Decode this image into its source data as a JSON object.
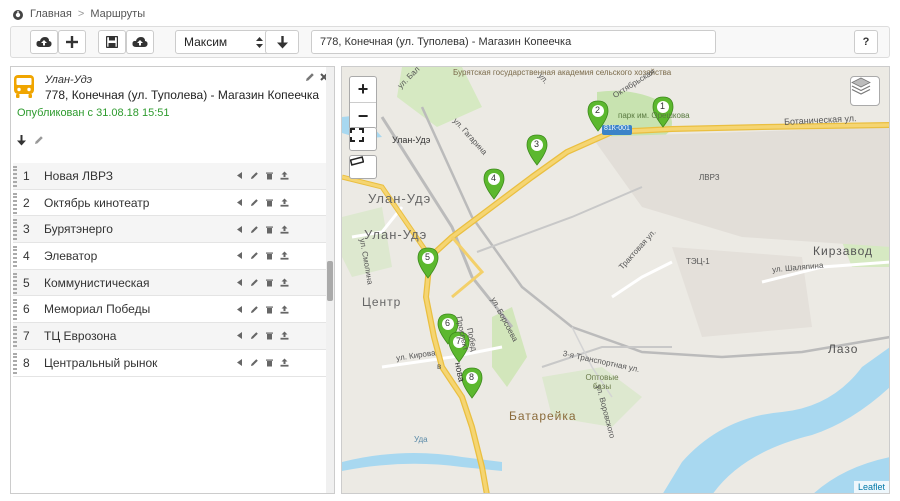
{
  "breadcrumb": {
    "home": "Главная",
    "separator": ">",
    "current": "Маршруты"
  },
  "toolbar": {
    "user_select": "Максим",
    "route_field": "778, Конечная (ул. Туполева) - Магазин Копеечка",
    "help_label": "?"
  },
  "route": {
    "city": "Улан-Удэ",
    "title": "778, Конечная (ул. Туполева) - Магазин Копеечка",
    "published": "Опубликован с 31.08.18 15:51"
  },
  "stops": [
    {
      "num": "1",
      "name": "Новая ЛВРЗ"
    },
    {
      "num": "2",
      "name": "Октябрь кинотеатр"
    },
    {
      "num": "3",
      "name": "Бурятэнерго"
    },
    {
      "num": "4",
      "name": "Элеватор"
    },
    {
      "num": "5",
      "name": "Коммунистическая"
    },
    {
      "num": "6",
      "name": "Мемориал Победы"
    },
    {
      "num": "7",
      "name": "ТЦ Еврозона"
    },
    {
      "num": "8",
      "name": "Центральный рынок"
    }
  ],
  "map": {
    "labels": {
      "city1": "Улан-Удэ",
      "city2": "Улан-Удэ",
      "city3": "Улан-Удэ",
      "centr": "Центр",
      "kirzavod": "Кирзавод",
      "lazo": "Лазо",
      "batareyka": "Батарейка",
      "academy": "Бурятская государственная академия сельского хозяйства",
      "park": "парк им. Орешкова",
      "botan": "Ботаническая ул.",
      "oktyabr": "Октябрьская",
      "gagarina": "ул. Гагарина",
      "traktovaya": "Трактовая ул.",
      "shalyapina": "ул. Шаляпина",
      "tec": "ТЭЦ-1",
      "lvrz": "ЛВРЗ",
      "borsoeva": "ул. Борсоева",
      "kirova": "ул. Кирова",
      "smolina": "ул. Смолина",
      "transport": "3-я Транспортная ул.",
      "optovye": "Оптовые базы",
      "uda": "Уда",
      "highway": "81К-001",
      "bal": "ул. Бал",
      "yanova": "нова",
      "pobedy": "Побед",
      "prospekt": "Проспект",
      "pospekt2": "в",
      "vorovskogo": "ул. Воровского",
      "verhnyaya": "ул."
    },
    "markers": [
      "1",
      "2",
      "3",
      "4",
      "5",
      "6",
      "7",
      "8"
    ],
    "attribution": "Leaflet",
    "zoom_in": "+",
    "zoom_out": "−"
  },
  "colors": {
    "route": "#f5c842",
    "marker": "#5cb82e",
    "published": "#2e9b2e",
    "water": "#a8d8f0",
    "park": "#cde7b0"
  }
}
